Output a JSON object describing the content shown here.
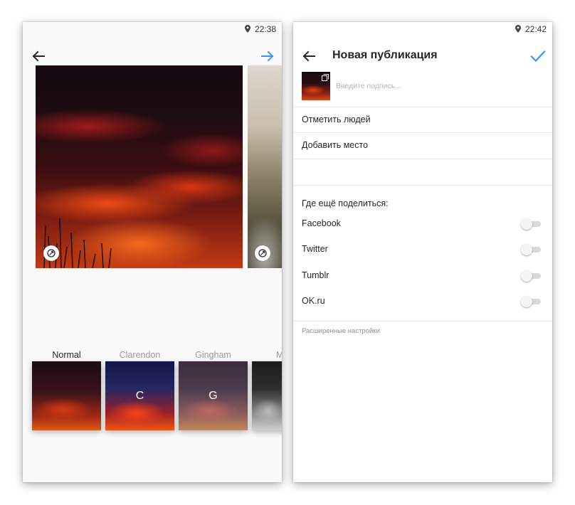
{
  "left": {
    "status": {
      "time": "22:38"
    },
    "photos": [
      {
        "name": "sunset"
      },
      {
        "name": "meadow"
      }
    ],
    "filters": [
      {
        "label": "Normal",
        "letter": "",
        "active": true
      },
      {
        "label": "Clarendon",
        "letter": "C",
        "active": false
      },
      {
        "label": "Gingham",
        "letter": "G",
        "active": false
      },
      {
        "label": "M",
        "letter": "",
        "active": false
      }
    ],
    "icons": {
      "back": "arrow-left-icon",
      "next": "arrow-right-icon",
      "rotate": "rotate-icon"
    },
    "colors": {
      "accent": "#3897f0"
    }
  },
  "right": {
    "status": {
      "time": "22:42"
    },
    "header": {
      "title": "Новая публикация"
    },
    "caption": {
      "placeholder": "Введите подпись..."
    },
    "menu": {
      "tag_people": "Отметить людей",
      "add_location": "Добавить место"
    },
    "share": {
      "title": "Где ещё поделиться:",
      "services": [
        {
          "label": "Facebook",
          "enabled": false
        },
        {
          "label": "Twitter",
          "enabled": false
        },
        {
          "label": "Tumblr",
          "enabled": false
        },
        {
          "label": "OK.ru",
          "enabled": false
        }
      ]
    },
    "advanced_label": "Расширенные настройки",
    "icons": {
      "back": "arrow-left-icon",
      "confirm": "checkmark-icon",
      "multi": "multiple-photos-icon",
      "location": "location-pin-icon"
    },
    "colors": {
      "accent": "#3897f0"
    }
  }
}
